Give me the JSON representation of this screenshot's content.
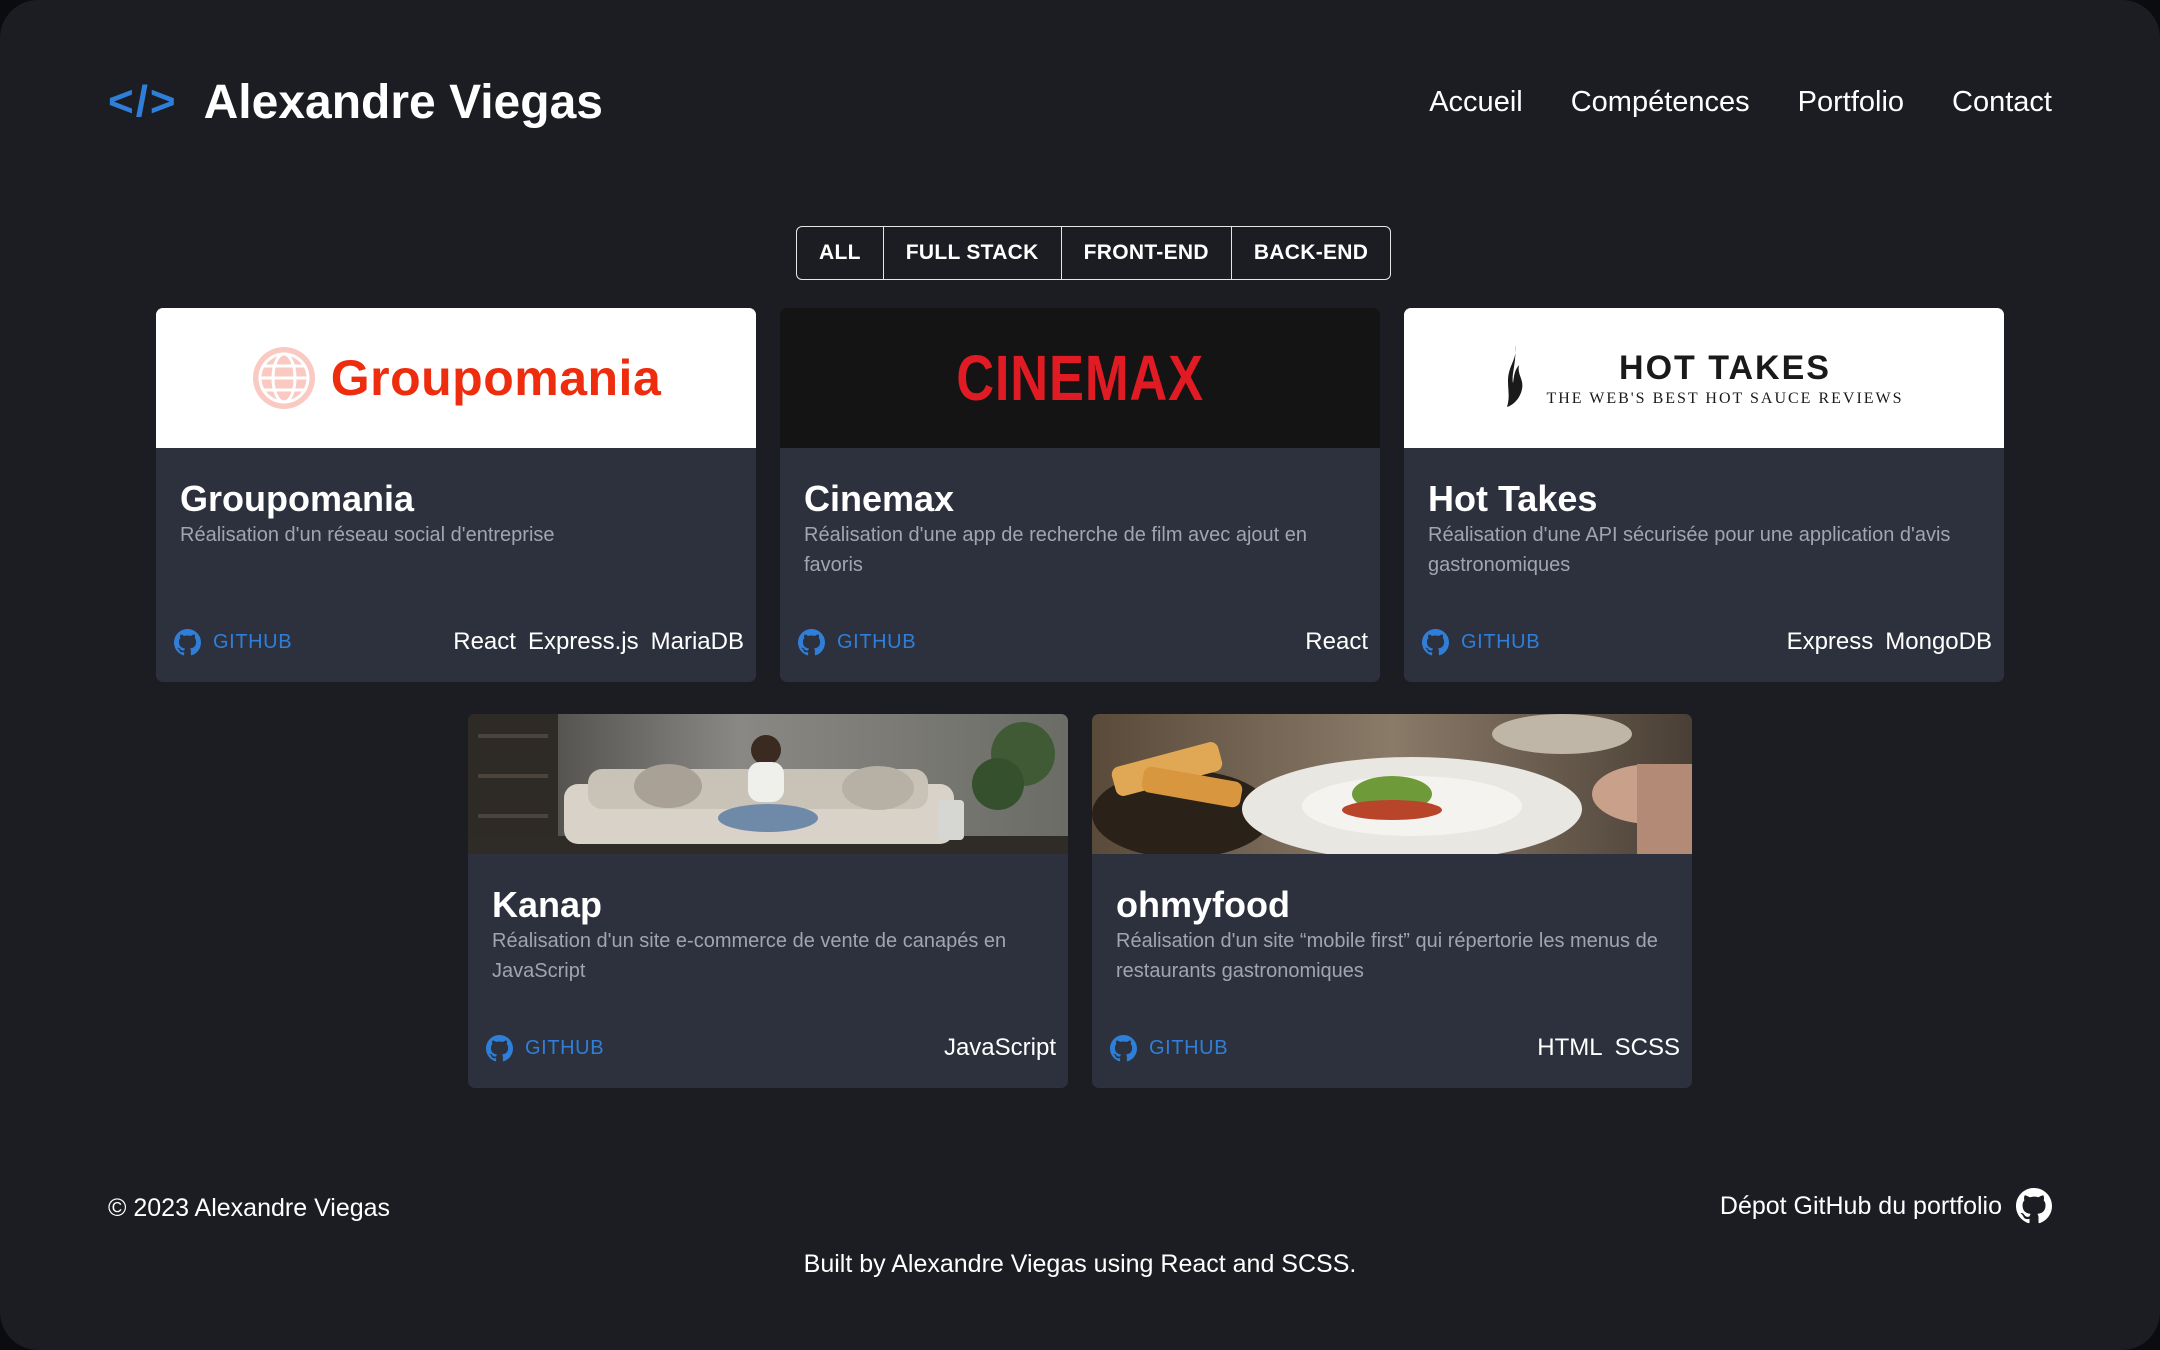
{
  "header": {
    "logo_symbol": "</>",
    "name": "Alexandre Viegas",
    "nav": [
      "Accueil",
      "Compétences",
      "Portfolio",
      "Contact"
    ]
  },
  "filters": [
    "ALL",
    "FULL STACK",
    "FRONT-END",
    "BACK-END"
  ],
  "projects": [
    {
      "logo_text": "Groupomania",
      "title": "Groupomania",
      "description": "Réalisation d'un réseau social d'entreprise",
      "github_label": "GITHUB",
      "tags": [
        "React",
        "Express.js",
        "MariaDB"
      ]
    },
    {
      "logo_text": "CINEMAX",
      "title": "Cinemax",
      "description": "Réalisation d'une app de recherche de film avec ajout en favoris",
      "github_label": "GITHUB",
      "tags": [
        "React"
      ]
    },
    {
      "logo_title": "HOT TAKES",
      "logo_subtitle": "THE WEB'S BEST HOT SAUCE REVIEWS",
      "title": "Hot Takes",
      "description": "Réalisation d'une API sécurisée pour une application d'avis gastronomiques",
      "github_label": "GITHUB",
      "tags": [
        "Express",
        "MongoDB"
      ]
    },
    {
      "title": "Kanap",
      "description": "Réalisation d'un site e-commerce de vente de canapés en JavaScript",
      "github_label": "GITHUB",
      "tags": [
        "JavaScript"
      ]
    },
    {
      "title": "ohmyfood",
      "description": "Réalisation d'un site “mobile first” qui répertorie les menus de restaurants gastronomiques",
      "github_label": "GITHUB",
      "tags": [
        "HTML",
        "SCSS"
      ]
    }
  ],
  "footer": {
    "copyright": "© 2023 Alexandre Viegas",
    "repo_link": "Dépot GitHub du portfolio",
    "built_by": "Built by Alexandre Viegas using React and SCSS."
  },
  "colors": {
    "accent": "#2f7fd8",
    "background": "#1b1d22",
    "card": "#2c313d",
    "groupomania_red": "#ee2c0e",
    "cinemax_red": "#e11b24"
  },
  "icons": {
    "github": "github-icon",
    "brand": "code-icon"
  }
}
